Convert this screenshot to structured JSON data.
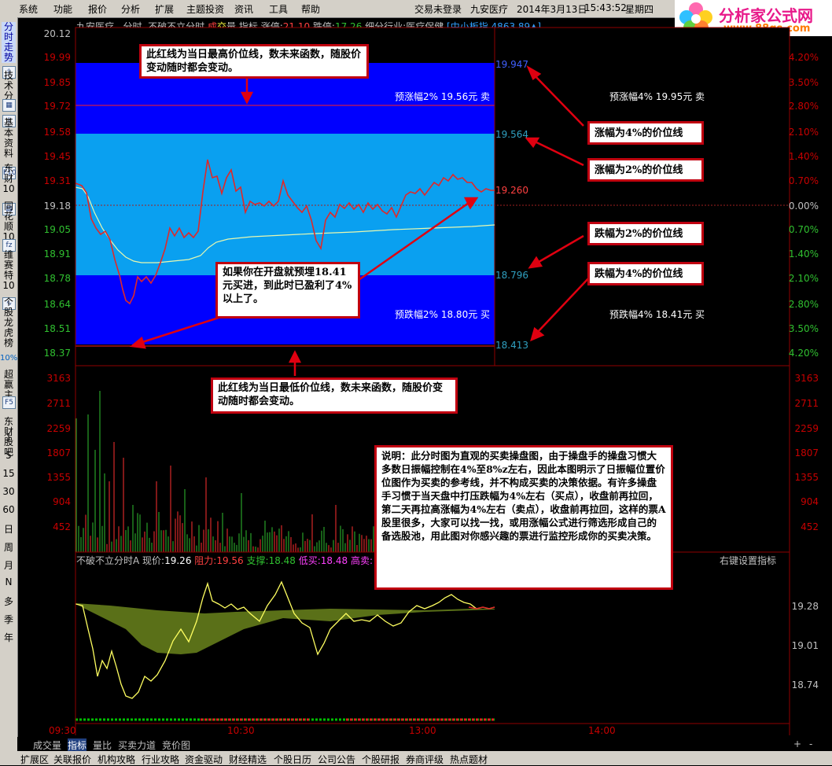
{
  "menu": {
    "items": [
      "系统",
      "功能",
      "报价",
      "分析",
      "扩展",
      "主题投资",
      "资讯",
      "工具",
      "帮助"
    ],
    "right": [
      "交易未登录",
      "九安医疗",
      "2014年3月13日",
      "15:43:52",
      "星期四"
    ]
  },
  "logo": {
    "text": "分析家公式网",
    "url_text": "www.88gs.com"
  },
  "left_toolbar": {
    "vertical_labels": [
      "分时走势",
      "技术分析",
      "基本资料",
      "东财10",
      "同花顺10",
      "维赛特10",
      "个股龙虎榜",
      "超赢主力",
      "东财股吧"
    ],
    "icon_labels": [
      "F10",
      "F5",
      "10%"
    ],
    "period_labels": [
      "1",
      "5",
      "15",
      "30",
      "60",
      "日",
      "周",
      "月",
      "N",
      "多",
      "季",
      "年"
    ]
  },
  "info_line": {
    "stock": "九安医疗",
    "mode": "分时",
    "formula": "不破不立分时",
    "cheng": "成",
    "jiao": "交",
    "liang": "量",
    "indicator": "指标",
    "zhangting_label": "涨停:",
    "zhangting": "21.10",
    "dieting_label": "跌停:",
    "dieting": "17.26",
    "industry": "细分行业:医疗保健",
    "index_name": "[中小板指",
    "index_value": "4863.89",
    "index_arrow": "▲]"
  },
  "price_axis_left": [
    "20.12",
    "19.99",
    "19.85",
    "19.72",
    "19.58",
    "19.45",
    "19.31",
    "19.18",
    "19.05",
    "18.91",
    "18.78",
    "18.64",
    "18.51",
    "18.37"
  ],
  "price_axis_right": [
    "4.20%",
    "3.50%",
    "2.80%",
    "2.10%",
    "1.40%",
    "0.70%",
    "0.00%",
    "0.70%",
    "1.40%",
    "2.10%",
    "2.80%",
    "3.50%",
    "4.20%"
  ],
  "volume_axis": [
    "3163",
    "2711",
    "2259",
    "1807",
    "1355",
    "904",
    "452"
  ],
  "indicator_axis": [
    "19.28",
    "19.01",
    "18.74"
  ],
  "price_levels": {
    "up4": "19.947",
    "up2": "19.564",
    "current": "19.260",
    "down2": "18.796",
    "down4": "18.413",
    "label_up2": "预涨幅2% 19.56元 卖",
    "label_up4": "预涨幅4% 19.95元 卖",
    "label_down2": "预跌幅2% 18.80元 买",
    "label_down4": "预跌幅4% 18.41元 买"
  },
  "indicator_line": {
    "name": "不破不立分时A",
    "price_label": "现价:",
    "price": "19.26",
    "resist_label": "阻力:",
    "resist": "19.56",
    "support_label": "支撑:",
    "support": "18.48",
    "lowbuy_label": "低买:",
    "lowbuy": "18.48",
    "highsell_label": "高卖:",
    "right_hint": "右键设置指标"
  },
  "time_axis": [
    "09:30",
    "10:30",
    "13:00",
    "14:00"
  ],
  "callouts": {
    "top": "此红线为当日最高价位线，数未来函数，随股价变动随时都会变动。",
    "up4": "涨幅为4%的价位线",
    "up2": "涨幅为2%的价位线",
    "down2": "跌幅为2%的价位线",
    "down4": "跌幅为4%的价位线",
    "middle": "如果你在开盘就预埋18.41元买进，到此时已盈利了4%以上了。",
    "bottom": "此红线为当日最低价位线，数未来函数，随股价变动随时都会变动。",
    "note": "说明：此分时图为直观的买卖操盘图，由于操盘手的操盘习惯大多数日振幅控制在4%至8%z左右，因此本图明示了日振幅位置价位图作为买卖的参考线，并不构成买卖的决策依据。有许多操盘手习惯于当天盘中打压跌幅为4%左右（买点），收盘前再拉回，第二天再拉高涨幅为4%左右（卖点），收盘前再拉回，这样的票A股里很多，大家可以找一找，或用涨幅公式进行筛选形成自己的备选股池，用此图对你感兴趣的票进行监控形成你的买卖决策。"
  },
  "bottom_tabs": [
    "成交量",
    "指标",
    "量比",
    "买卖力道",
    "竞价图"
  ],
  "bottom_bar": [
    "扩展区",
    "关联报价",
    "机构攻略",
    "行业攻略",
    "资金驱动",
    "财经精选",
    "个股日历",
    "公司公告",
    "个股研报",
    "券商评级",
    "热点题材"
  ],
  "zoom": [
    "+",
    "-"
  ],
  "colors": {
    "blue_band": "#0000ff",
    "light_band": "#0aa0f0",
    "price_line": "#e02828",
    "avg_line": "#d8f0a0",
    "up": "#ff3030",
    "down": "#30c030"
  }
}
